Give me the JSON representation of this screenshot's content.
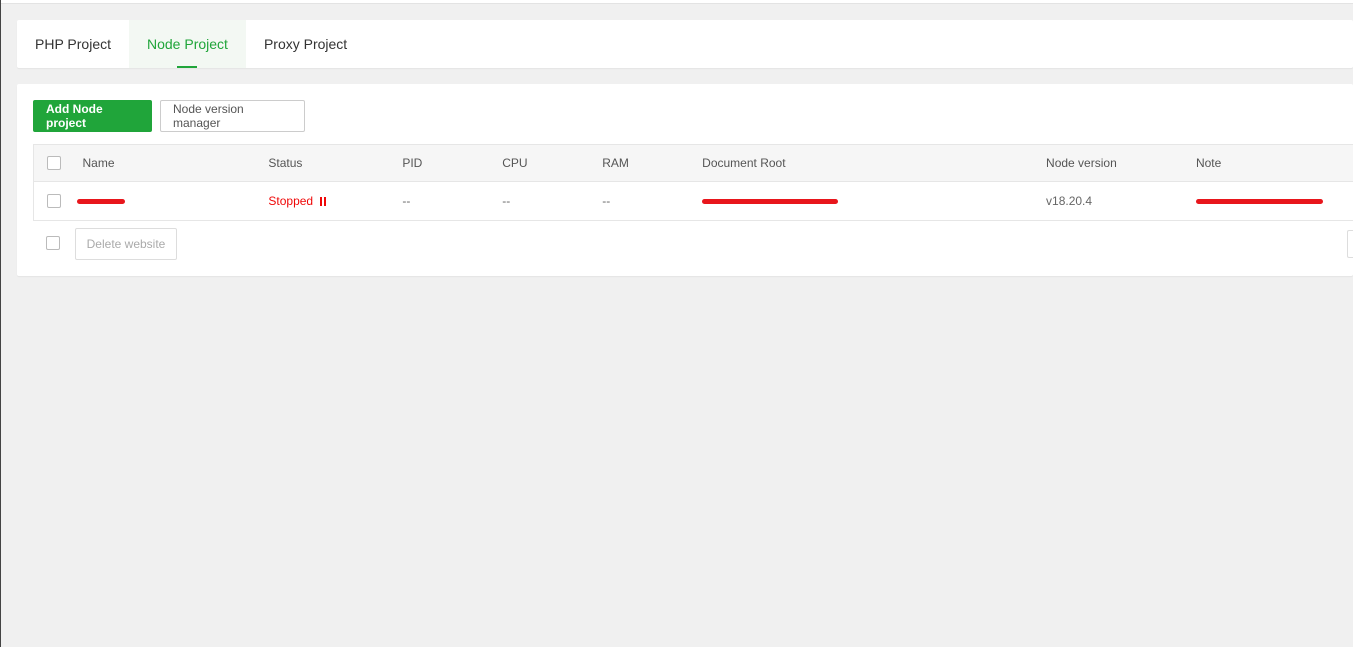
{
  "tabs": [
    {
      "label": "PHP Project",
      "active": false
    },
    {
      "label": "Node Project",
      "active": true
    },
    {
      "label": "Proxy Project",
      "active": false
    }
  ],
  "toolbar": {
    "add_label": "Add Node project",
    "version_manager_label": "Node version manager"
  },
  "table": {
    "headers": {
      "name": "Name",
      "status": "Status",
      "pid": "PID",
      "cpu": "CPU",
      "ram": "RAM",
      "document_root": "Document Root",
      "node_version": "Node version",
      "note": "Note"
    },
    "rows": [
      {
        "status": "Stopped",
        "pid": "--",
        "cpu": "--",
        "ram": "--",
        "node_version": "v18.20.4"
      }
    ]
  },
  "footer": {
    "delete_label": "Delete website"
  },
  "colors": {
    "accent": "#20a53a",
    "stopped": "#ef0808",
    "redaction": "#e8161c"
  }
}
